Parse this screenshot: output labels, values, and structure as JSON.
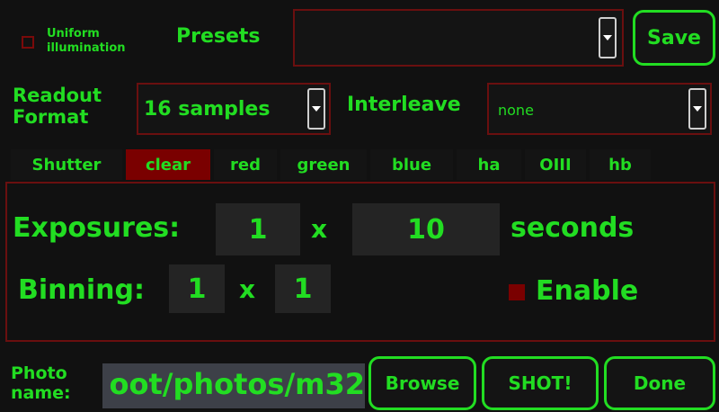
{
  "options": {
    "uniform_illumination_line1": "Uniform",
    "uniform_illumination_line2": "illumination",
    "uniform_illumination_checked": false
  },
  "presets": {
    "label": "Presets",
    "value": "",
    "save_label": "Save"
  },
  "readout": {
    "label_line1": "Readout",
    "label_line2": "Format",
    "value": "16 samples"
  },
  "interleave": {
    "label": "Interleave",
    "value": "none"
  },
  "tabs": [
    {
      "label": "Shutter",
      "active": false
    },
    {
      "label": "clear",
      "active": true
    },
    {
      "label": "red",
      "active": false
    },
    {
      "label": "green",
      "active": false
    },
    {
      "label": "blue",
      "active": false
    },
    {
      "label": "ha",
      "active": false
    },
    {
      "label": "OIII",
      "active": false
    },
    {
      "label": "hb",
      "active": false
    }
  ],
  "exposures": {
    "label": "Exposures:",
    "count": "1",
    "times": "x",
    "duration": "10",
    "unit": "seconds"
  },
  "binning": {
    "label": "Binning:",
    "x": "1",
    "times": "x",
    "y": "1"
  },
  "enable": {
    "label": "Enable",
    "color": "#7a0000"
  },
  "photo": {
    "label_line1": "Photo",
    "label_line2": "name:",
    "value": "oot/photos/m32",
    "browse_label": "Browse",
    "shot_label": "SHOT!",
    "done_label": "Done"
  },
  "colors": {
    "accent": "#22dd22",
    "border_red": "#7a0a0a",
    "background": "#111111"
  }
}
